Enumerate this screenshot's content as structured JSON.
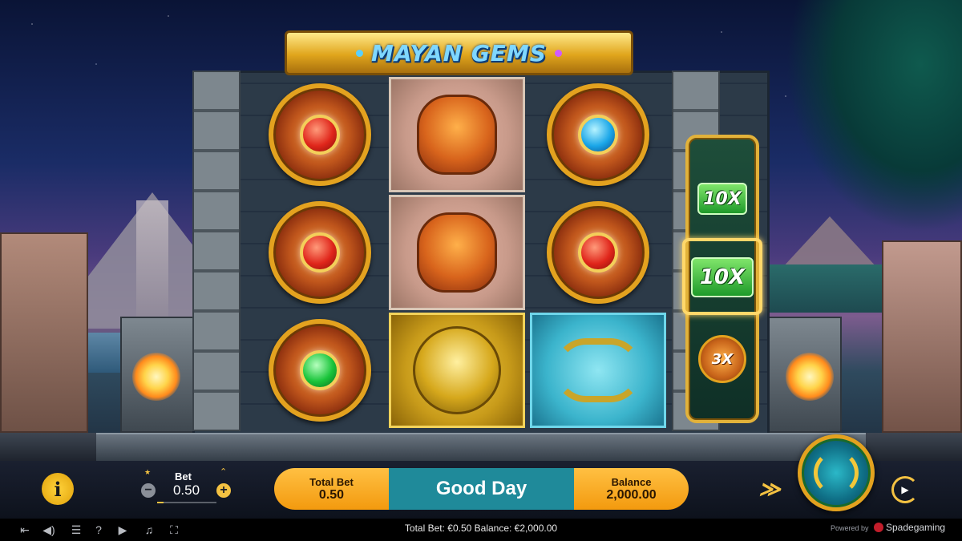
{
  "game": {
    "title": "MAYAN GEMS",
    "colors": {
      "accent": "#f4c242",
      "teal": "#1f8a9a",
      "gold": "#e3a21f"
    }
  },
  "reels": {
    "columns": [
      [
        {
          "symbol": "red-gem-medallion",
          "gem": "red"
        },
        {
          "symbol": "red-gem-medallion",
          "gem": "red"
        },
        {
          "symbol": "green-gem-medallion",
          "gem": "green"
        }
      ],
      [
        {
          "symbol": "mayan-mask"
        },
        {
          "symbol": "mayan-mask"
        },
        {
          "symbol": "golden-sun-face"
        }
      ],
      [
        {
          "symbol": "blue-gem-medallion",
          "gem": "blue"
        },
        {
          "symbol": "red-gem-medallion",
          "gem": "red"
        },
        {
          "symbol": "jade-serpent"
        }
      ]
    ]
  },
  "multiplier_reel": {
    "top": "10X",
    "active": "10X",
    "bottom": "3X"
  },
  "controls": {
    "bet_label": "Bet",
    "bet_value": "0.50",
    "bet_minus": "−",
    "bet_plus": "+",
    "total_bet_label": "Total Bet",
    "total_bet_value": "0.50",
    "message": "Good Day",
    "balance_label": "Balance",
    "balance_value": "2,000.00",
    "info": "i"
  },
  "status_bar": {
    "text": "Total Bet: €0.50  Balance: €2,000.00",
    "powered_by": "Powered by",
    "brand": "Spadegaming"
  }
}
